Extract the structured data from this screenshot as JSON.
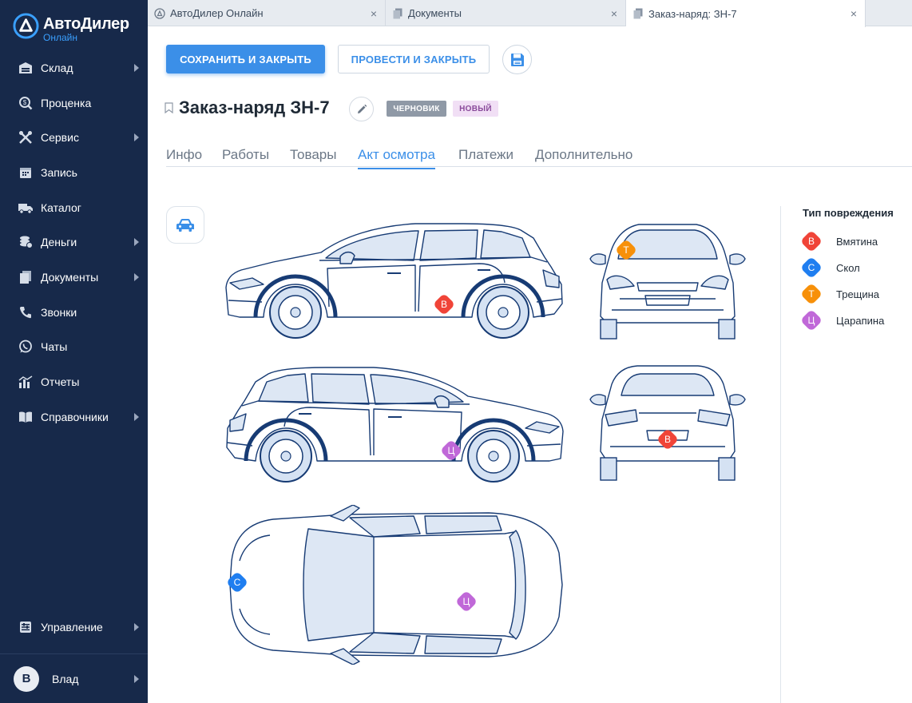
{
  "app": {
    "logo_title": "АвтоДилер",
    "logo_sub": "Онлайн"
  },
  "colors": {
    "sidebar": "#17294a",
    "accent": "#3b8fe8",
    "dent": "#f04438",
    "chip": "#1f7ef0",
    "crack": "#f79009",
    "scratch": "#c068d8",
    "car_outline": "#173b74",
    "car_fill": "#e4ecf7"
  },
  "sidebar": {
    "items": [
      {
        "label": "Склад",
        "icon": "warehouse-icon"
      },
      {
        "label": "Проценка",
        "icon": "price-search-icon"
      },
      {
        "label": "Сервис",
        "icon": "tools-icon"
      },
      {
        "label": "Запись",
        "icon": "calendar-icon"
      },
      {
        "label": "Каталог",
        "icon": "truck-icon"
      },
      {
        "label": "Деньги",
        "icon": "coins-icon"
      },
      {
        "label": "Документы",
        "icon": "documents-icon"
      },
      {
        "label": "Звонки",
        "icon": "phone-icon"
      },
      {
        "label": "Чаты",
        "icon": "whatsapp-icon"
      },
      {
        "label": "Отчеты",
        "icon": "chart-icon"
      },
      {
        "label": "Справочники",
        "icon": "book-icon"
      }
    ],
    "manage_label": "Управление",
    "user_name": "Влад",
    "user_initial": "В"
  },
  "tabs": [
    {
      "label": "АвтоДилер Онлайн",
      "close": "×"
    },
    {
      "label": "Документы",
      "close": "×"
    },
    {
      "label": "Заказ-наряд: ЗН-7",
      "close": "×"
    }
  ],
  "toolbar": {
    "save_close": "СОХРАНИТЬ И ЗАКРЫТЬ",
    "post_close": "ПРОВЕСТИ И ЗАКРЫТЬ"
  },
  "order": {
    "title": "Заказ-наряд ЗН-7",
    "status_draft": "ЧЕРНОВИК",
    "status_new": "НОВЫЙ"
  },
  "subtabs": [
    "Инфо",
    "Работы",
    "Товары",
    "Акт осмотра",
    "Платежи",
    "Дополнительно"
  ],
  "active_subtab": "Акт осмотра",
  "legend": {
    "title": "Тип повреждения",
    "items": [
      {
        "letter": "В",
        "label": "Вмятина"
      },
      {
        "letter": "С",
        "label": "Скол"
      },
      {
        "letter": "Т",
        "label": "Трещина"
      },
      {
        "letter": "Ц",
        "label": "Царапина"
      }
    ]
  },
  "damage_markers": [
    {
      "view": "left-side",
      "letter": "В",
      "type": "Вмятина"
    },
    {
      "view": "front",
      "letter": "Т",
      "type": "Трещина"
    },
    {
      "view": "right-side",
      "letter": "Ц",
      "type": "Царапина"
    },
    {
      "view": "rear",
      "letter": "В",
      "type": "Вмятина"
    },
    {
      "view": "top",
      "letter": "С",
      "type": "Скол"
    },
    {
      "view": "top",
      "letter": "Ц",
      "type": "Царапина"
    }
  ]
}
